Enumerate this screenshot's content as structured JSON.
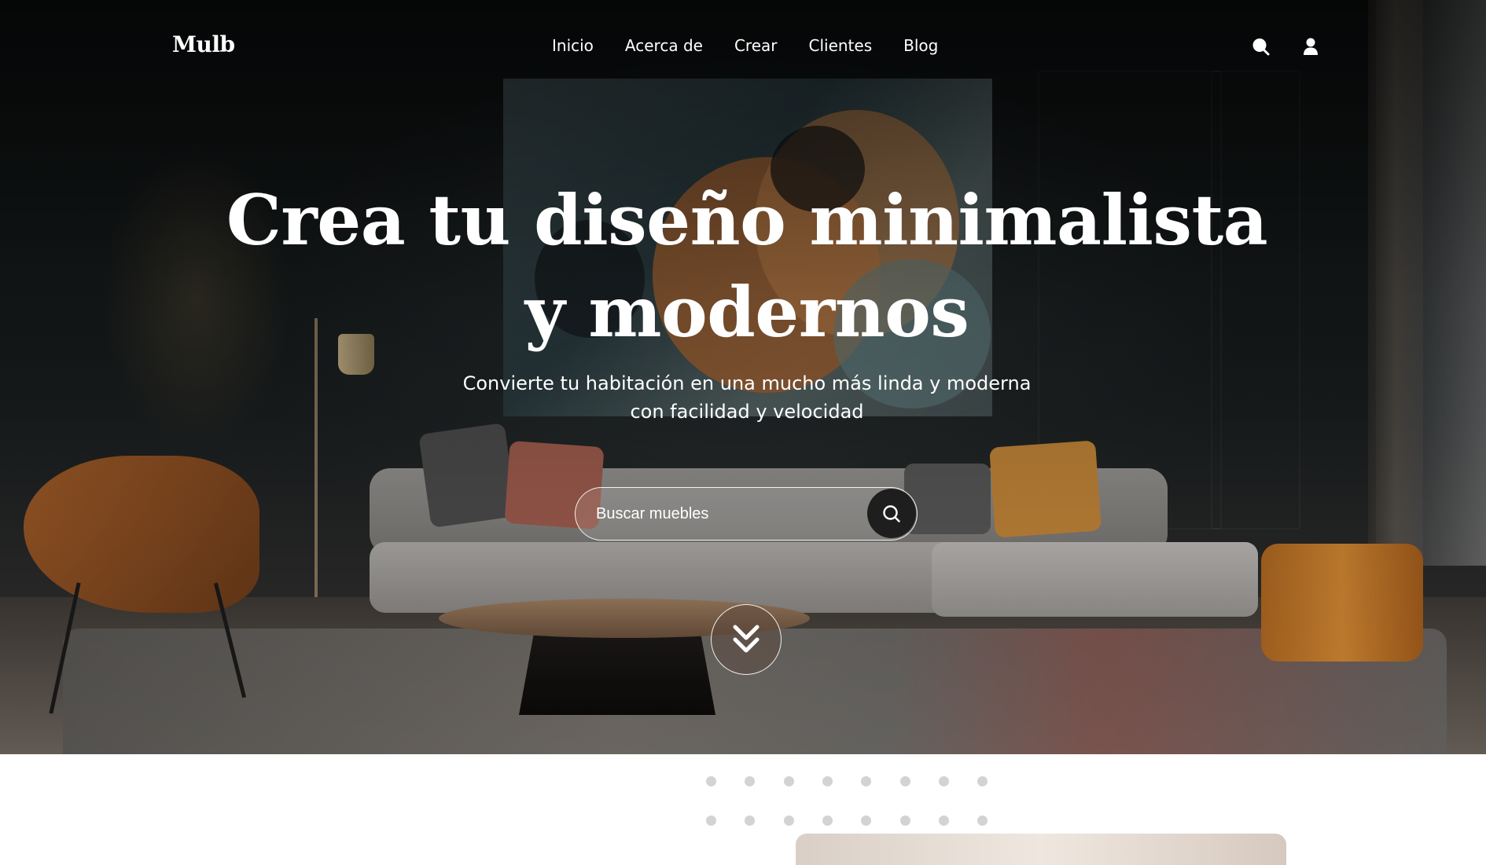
{
  "header": {
    "logo": "Mulb",
    "nav": [
      {
        "label": "Inicio"
      },
      {
        "label": "Acerca de"
      },
      {
        "label": "Crear"
      },
      {
        "label": "Clientes"
      },
      {
        "label": "Blog"
      }
    ],
    "icons": [
      "search-icon",
      "user-icon"
    ]
  },
  "hero": {
    "headline": "Crea tu diseño minimalista y modernos",
    "subtitle_line1": "Convierte tu habitación en una mucho más linda y moderna",
    "subtitle_line2": "con facilidad y velocidad",
    "search": {
      "placeholder": "Buscar muebles",
      "button_icon": "search-icon"
    },
    "scroll_icon": "double-chevron-down-icon"
  },
  "colors": {
    "text": "#ffffff",
    "search_button": "#1e1e1e",
    "dots": "#d3d3d3",
    "page_background": "#ffffff"
  }
}
